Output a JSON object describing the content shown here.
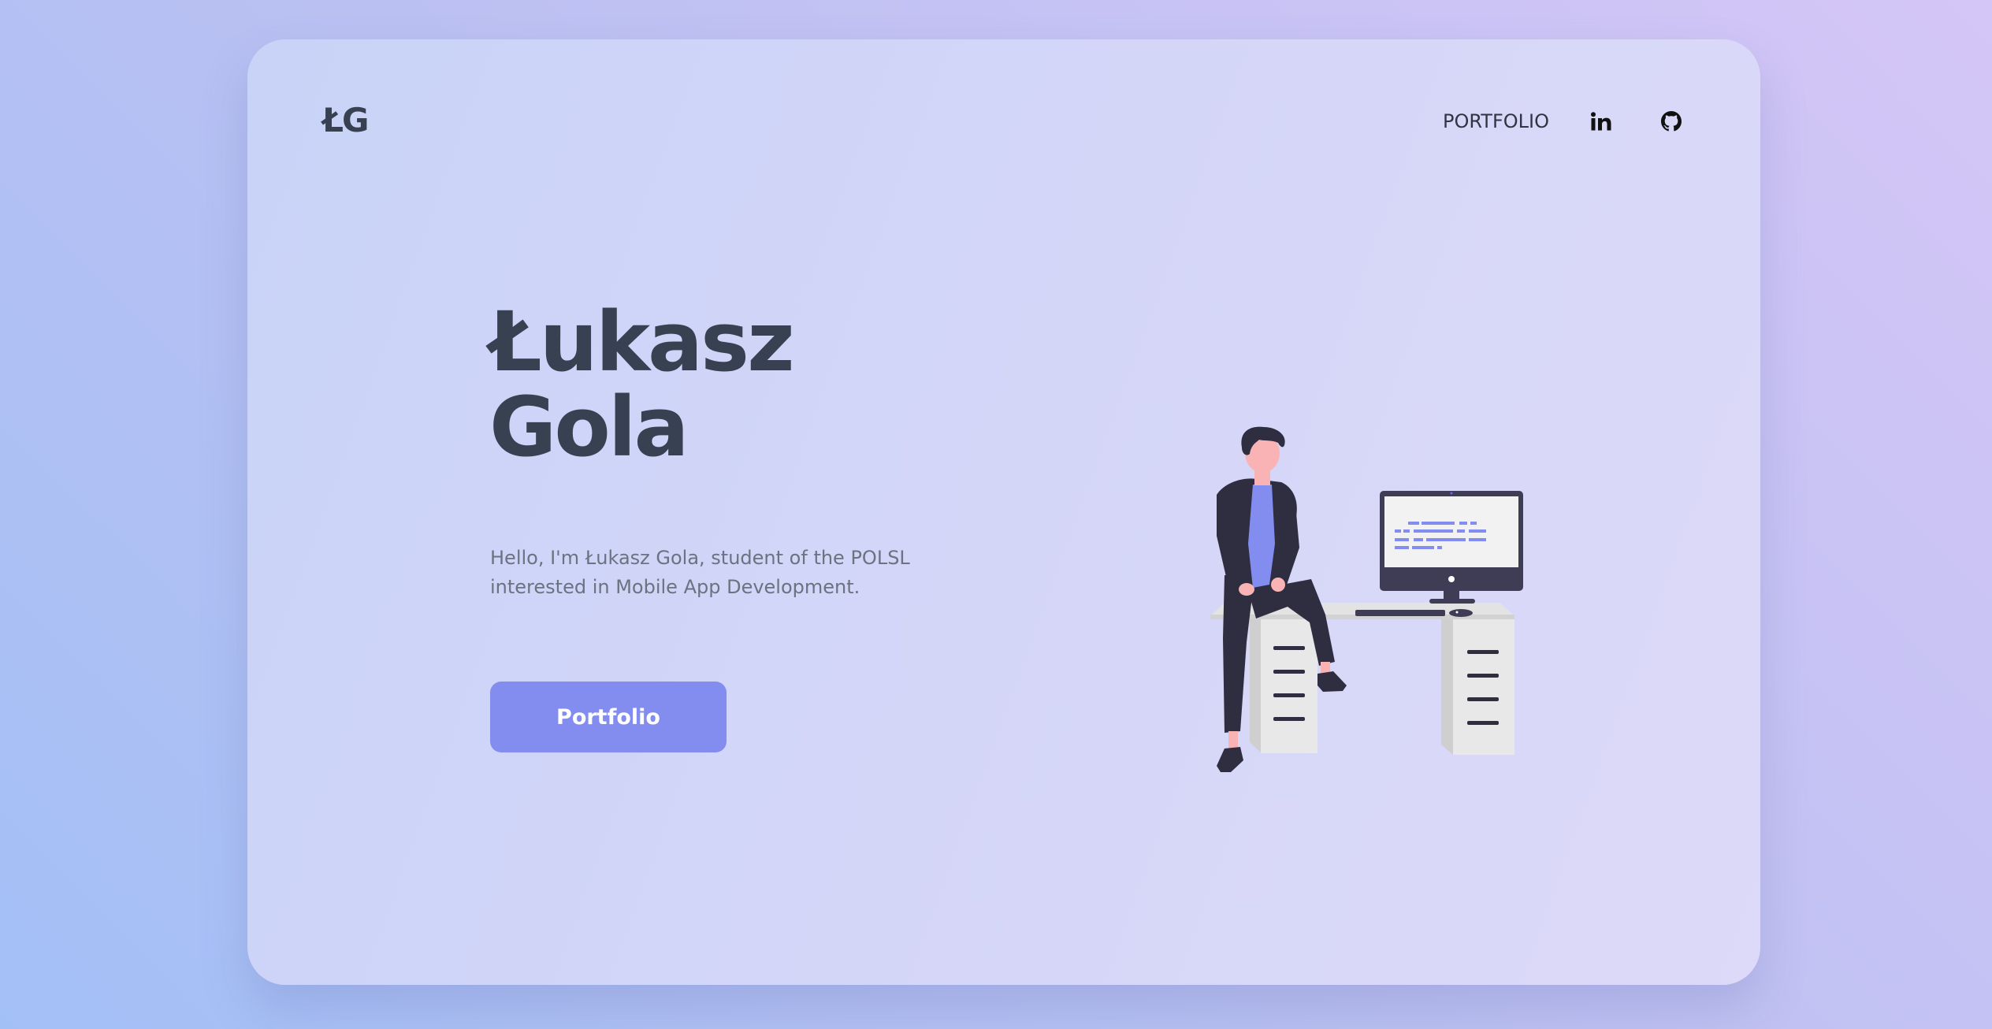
{
  "header": {
    "logo_text": "ŁG",
    "nav": {
      "portfolio_label": "PORTFOLIO",
      "linkedin_icon": "linkedin-icon",
      "github_icon": "github-icon"
    }
  },
  "hero": {
    "title_line1": "Łukasz",
    "title_line2": "Gola",
    "description_line1": "Hello, I'm Łukasz Gola, student of the POLSL",
    "description_line2": "interested in Mobile App Development.",
    "button_label": "Portfolio"
  },
  "illustration": {
    "name": "person-at-desk-illustration"
  },
  "colors": {
    "accent": "#838df0",
    "heading": "#374151",
    "body_text": "#6b7280",
    "card_bg": "#d3d6f8",
    "page_bg_start": "#a3c0f6",
    "page_bg_end": "#d4c6f6"
  }
}
